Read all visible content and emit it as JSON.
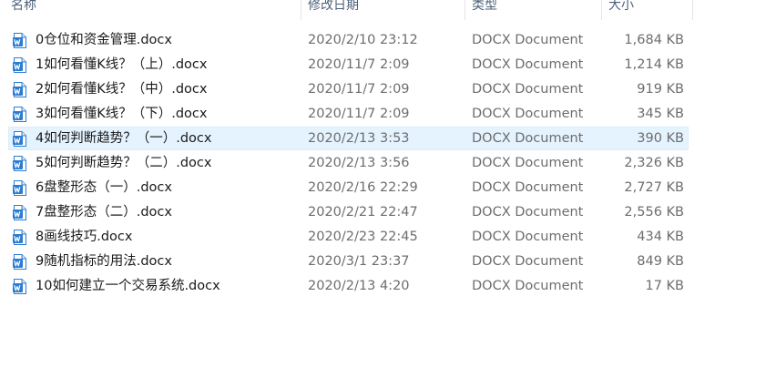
{
  "columns": {
    "name": "名称",
    "date": "修改日期",
    "type": "类型",
    "size": "大小"
  },
  "accent_color": "#2b7cd3",
  "selected_row_color": "#e5f3ff",
  "file_icon": "word-document-icon",
  "selected_index": 4,
  "files": [
    {
      "name": "0仓位和资金管理.docx",
      "date": "2020/2/10 23:12",
      "type": "DOCX Document",
      "size": "1,684 KB"
    },
    {
      "name": "1如何看懂K线？（上）.docx",
      "date": "2020/11/7 2:09",
      "type": "DOCX Document",
      "size": "1,214 KB"
    },
    {
      "name": "2如何看懂K线？（中）.docx",
      "date": "2020/11/7 2:09",
      "type": "DOCX Document",
      "size": "919 KB"
    },
    {
      "name": "3如何看懂K线？（下）.docx",
      "date": "2020/11/7 2:09",
      "type": "DOCX Document",
      "size": "345 KB"
    },
    {
      "name": "4如何判断趋势？（一）.docx",
      "date": "2020/2/13 3:53",
      "type": "DOCX Document",
      "size": "390 KB"
    },
    {
      "name": "5如何判断趋势？（二）.docx",
      "date": "2020/2/13 3:56",
      "type": "DOCX Document",
      "size": "2,326 KB"
    },
    {
      "name": "6盘整形态（一）.docx",
      "date": "2020/2/16 22:29",
      "type": "DOCX Document",
      "size": "2,727 KB"
    },
    {
      "name": "7盘整形态（二）.docx",
      "date": "2020/2/21 22:47",
      "type": "DOCX Document",
      "size": "2,556 KB"
    },
    {
      "name": "8画线技巧.docx",
      "date": "2020/2/23 22:45",
      "type": "DOCX Document",
      "size": "434 KB"
    },
    {
      "name": "9随机指标的用法.docx",
      "date": "2020/3/1 23:37",
      "type": "DOCX Document",
      "size": "849 KB"
    },
    {
      "name": "10如何建立一个交易系统.docx",
      "date": "2020/2/13 4:20",
      "type": "DOCX Document",
      "size": "17 KB"
    }
  ]
}
